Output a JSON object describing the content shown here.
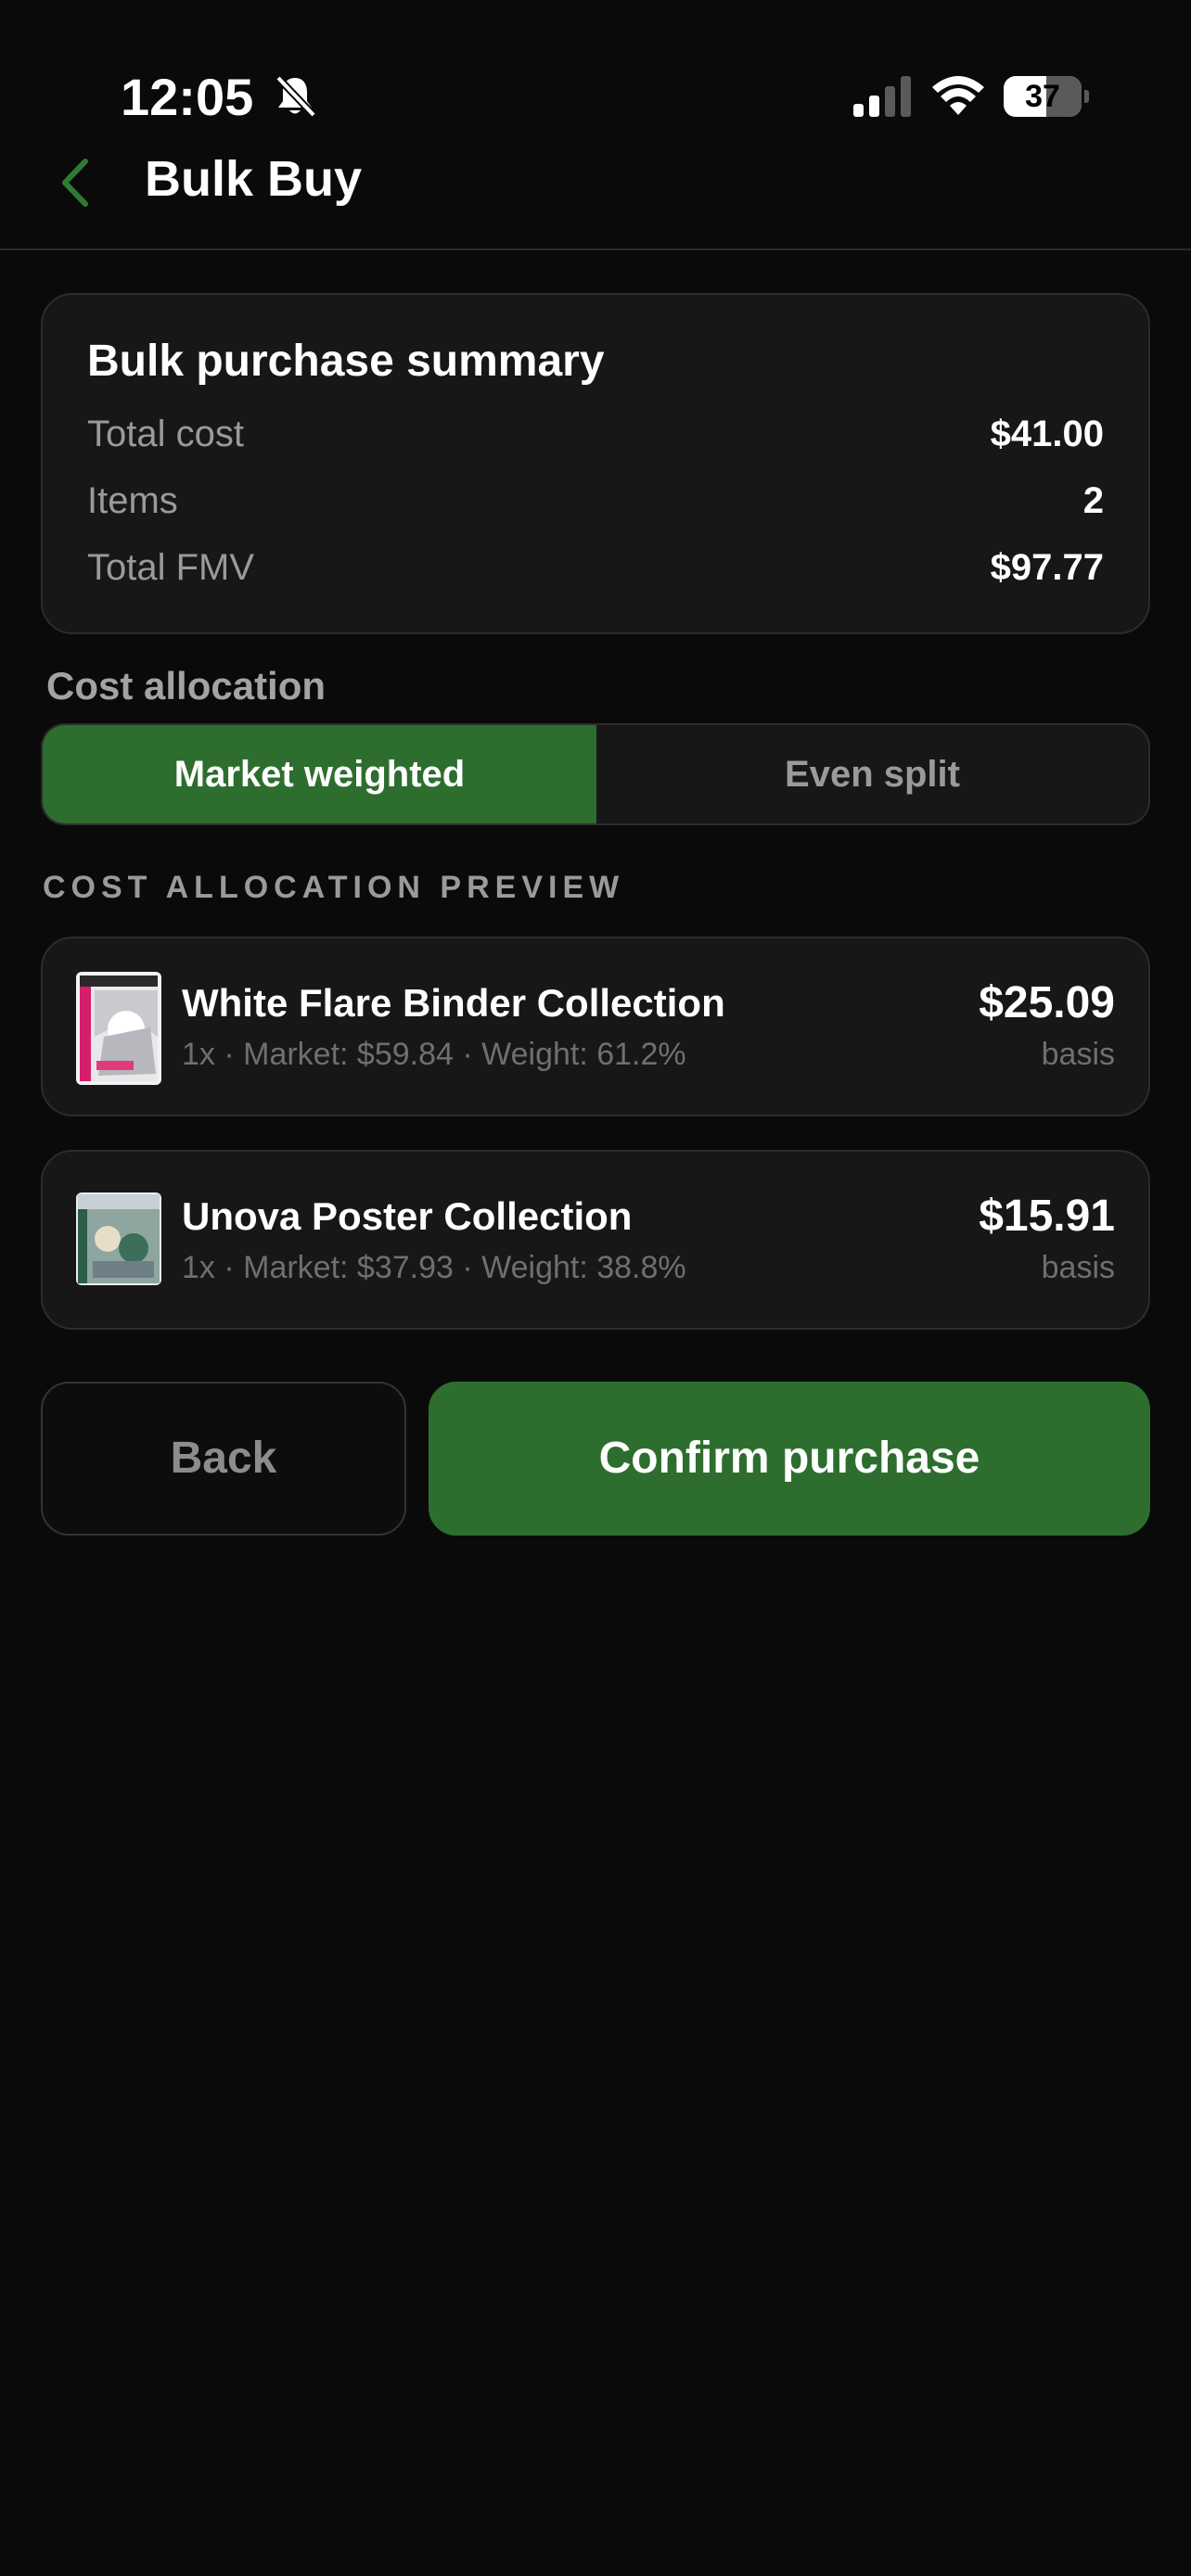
{
  "status_bar": {
    "time": "12:05",
    "battery": "37",
    "icons": [
      "bell-slash-icon",
      "cellular-signal-icon",
      "wifi-icon",
      "battery-icon"
    ]
  },
  "header": {
    "title": "Bulk Buy",
    "back_icon": "chevron-left-icon"
  },
  "summary": {
    "title": "Bulk purchase summary",
    "rows": [
      {
        "label": "Total cost",
        "value": "$41.00"
      },
      {
        "label": "Items",
        "value": "2"
      },
      {
        "label": "Total FMV",
        "value": "$97.77"
      }
    ]
  },
  "cost_allocation": {
    "label": "Cost allocation",
    "options": [
      {
        "label": "Market weighted",
        "selected": true
      },
      {
        "label": "Even split",
        "selected": false
      }
    ]
  },
  "preview": {
    "heading": "COST ALLOCATION PREVIEW",
    "items": [
      {
        "name": "White Flare Binder Collection",
        "details": "1x · Market: $59.84 · Weight: 61.2%",
        "price": "$25.09",
        "basis_label": "basis"
      },
      {
        "name": "Unova Poster Collection",
        "details": "1x · Market: $37.93 · Weight: 38.8%",
        "price": "$15.91",
        "basis_label": "basis"
      }
    ]
  },
  "actions": {
    "back_label": "Back",
    "confirm_label": "Confirm purchase"
  },
  "colors": {
    "background": "#0a0a0a",
    "card": "#171717",
    "accent_green": "#2d6e2f",
    "muted_text": "#9a9a9a"
  }
}
